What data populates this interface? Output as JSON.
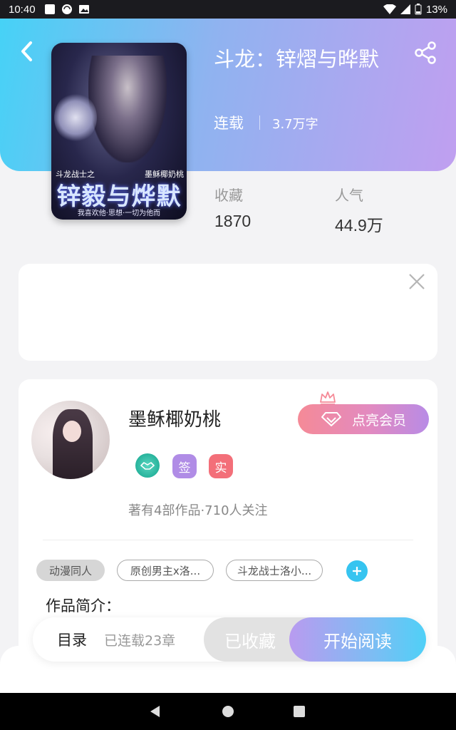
{
  "status_bar": {
    "time": "10:40",
    "battery": "13%"
  },
  "book": {
    "title": "斗龙：锌熠与晔默",
    "status": "连载",
    "word_count": "3.7万字",
    "cover": {
      "title": "锌毅与烨默",
      "top_left": "斗龙战士之",
      "top_right": "墨稣椰奶桃",
      "bottom": "我喜欢他·思想·一切为他而"
    },
    "stats": [
      {
        "label": "收藏",
        "value": "1870"
      },
      {
        "label": "人气",
        "value": "44.9万"
      }
    ]
  },
  "author": {
    "name": "墨稣椰奶桃",
    "vip_button": "点亮会员",
    "badges": [
      "签",
      "实"
    ],
    "stats": "著有4部作品·710人关注"
  },
  "tags": [
    "动漫同人",
    "原创男主x洛...",
    "斗龙战士洛小..."
  ],
  "intro_title": "作品简介：",
  "action_bar": {
    "toc": "目录",
    "chapters": "已连载23章",
    "collected": "已收藏",
    "read": "开始阅读"
  },
  "colors": {
    "accent_cyan": "#46d2f6",
    "accent_purple": "#c09ff0",
    "vip_pink": "#f58a97",
    "tag_add": "#36c4f0"
  }
}
